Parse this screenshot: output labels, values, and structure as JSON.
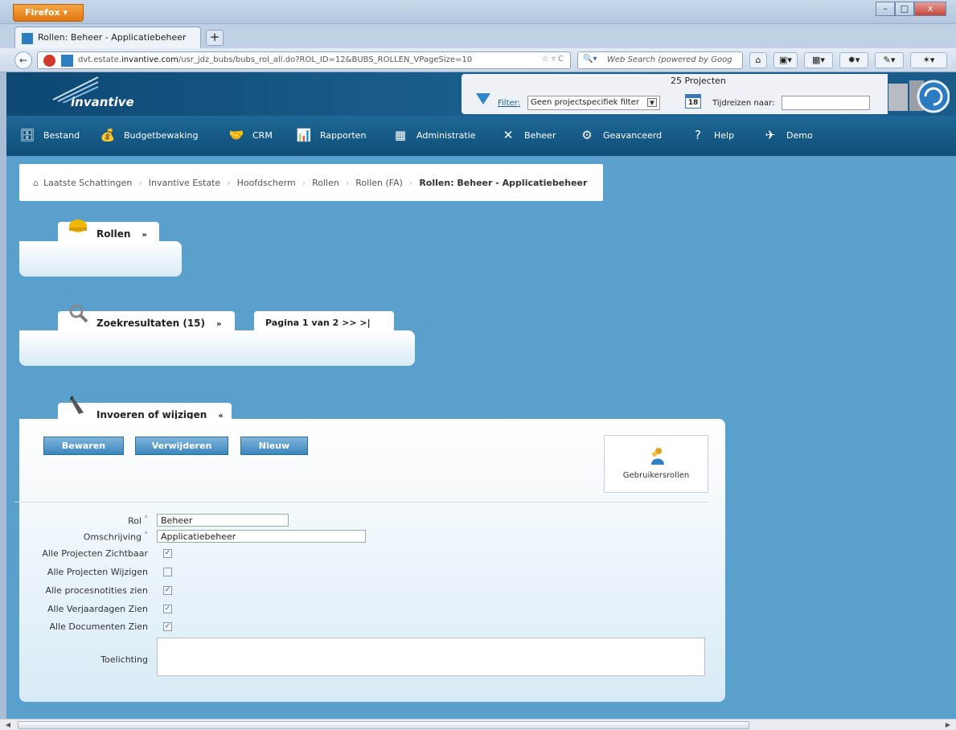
{
  "browser": {
    "menu_button": "Firefox",
    "tab_title": "Rollen: Beheer - Applicatiebeheer",
    "new_tab": "+",
    "url_prefix": "dvt.estate.",
    "url_domain": "invantive.com",
    "url_path": "/usr_jdz_bubs/bubs_rol_all.do?ROL_ID=12&BUBS_ROLLEN_VPageSize=10",
    "search_placeholder": "Web Search (powered by Goog",
    "window_controls": [
      "–",
      "□",
      "x"
    ]
  },
  "header": {
    "logo": "invantive",
    "project_count": "25 Projecten",
    "filter_label": "Filter",
    "filter_value": "Geen projectspecifiek filter",
    "calendar_day": "18",
    "time_travel_label": "Tijdreizen naar:",
    "time_travel_value": ""
  },
  "menu": [
    {
      "label": "Bestand",
      "icon": "file-cabinet-icon"
    },
    {
      "label": "Budgetbewaking",
      "icon": "money-icon"
    },
    {
      "label": "CRM",
      "icon": "handshake-icon"
    },
    {
      "label": "Rapporten",
      "icon": "presentation-icon"
    },
    {
      "label": "Administratie",
      "icon": "calculator-icon"
    },
    {
      "label": "Beheer",
      "icon": "tools-icon"
    },
    {
      "label": "Geavanceerd",
      "icon": "gears-icon"
    },
    {
      "label": "Help",
      "icon": "help-icon"
    },
    {
      "label": "Demo",
      "icon": "plane-icon"
    }
  ],
  "breadcrumb": [
    "Laatste Schattingen",
    "Invantive Estate",
    "Hoofdscherm",
    "Rollen",
    "Rollen (FA)",
    "Rollen: Beheer - Applicatiebeheer"
  ],
  "panels": {
    "rollen": {
      "title": "Rollen",
      "chevron": "»"
    },
    "zoek": {
      "title": "Zoekresultaten (15)",
      "chevron": "»",
      "pager": "Pagina 1 van 2 >> >|"
    },
    "invoer": {
      "title": "Invoeren of wijzigen",
      "chevron": "«"
    }
  },
  "buttons": {
    "save": "Bewaren",
    "delete": "Verwijderen",
    "new": "Nieuw",
    "user_roles": "Gebruikersrollen"
  },
  "form": {
    "rol_label": "Rol",
    "rol_value": "Beheer",
    "omschrijving_label": "Omschrijving",
    "omschrijving_value": "Applicatiebeheer",
    "required_mark": "*",
    "checkboxes": [
      {
        "label": "Alle Projecten Zichtbaar",
        "checked": true
      },
      {
        "label": "Alle Projecten Wijzigen",
        "checked": false
      },
      {
        "label": "Alle procesnotities zien",
        "checked": true
      },
      {
        "label": "Alle Verjaardagen Zien",
        "checked": true
      },
      {
        "label": "Alle Documenten Zien",
        "checked": true
      }
    ],
    "toelichting_label": "Toelichting",
    "toelichting_value": ""
  },
  "colors": {
    "brand_dark": "#0f4e78",
    "content_bg": "#5aa0cc",
    "button": "#3b86bd"
  }
}
